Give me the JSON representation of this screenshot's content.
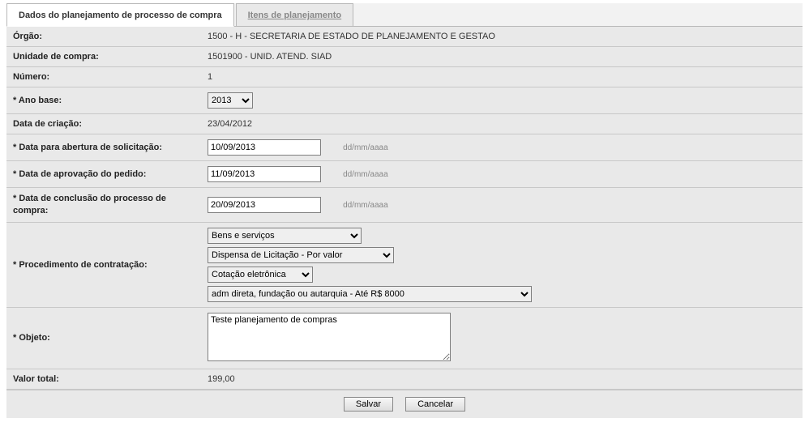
{
  "tabs": {
    "active": "Dados do planejamento de processo de compra",
    "other": "Itens de planejamento"
  },
  "labels": {
    "orgao": "Órgão:",
    "unidade": "Unidade de compra:",
    "numero": "Número:",
    "ano_base": "* Ano base:",
    "data_criacao": "Data de criação:",
    "data_abertura": "* Data para abertura de solicitação:",
    "data_aprovacao": "* Data de aprovação do pedido:",
    "data_conclusao": "* Data de conclusão do processo de compra:",
    "procedimento": "* Procedimento de contratação:",
    "objeto": "* Objeto:",
    "valor_total": "Valor total:"
  },
  "values": {
    "orgao": "1500 - H - SECRETARIA DE ESTADO DE PLANEJAMENTO E GESTAO",
    "unidade": "1501900 - UNID. ATEND. SIAD",
    "numero": "1",
    "ano_base": "2013",
    "data_criacao": "23/04/2012",
    "data_abertura": "10/09/2013",
    "data_aprovacao": "11/09/2013",
    "data_conclusao": "20/09/2013",
    "proc_tipo": "Bens e serviços",
    "proc_dispensa": "Dispensa de Licitação - Por valor",
    "proc_cotacao": "Cotação eletrônica",
    "proc_adm": "adm direta, fundação ou autarquia - Até R$ 8000",
    "objeto": "Teste planejamento de compras",
    "valor_total": "199,00"
  },
  "hints": {
    "date_format": "dd/mm/aaaa"
  },
  "buttons": {
    "salvar": "Salvar",
    "cancelar": "Cancelar"
  }
}
